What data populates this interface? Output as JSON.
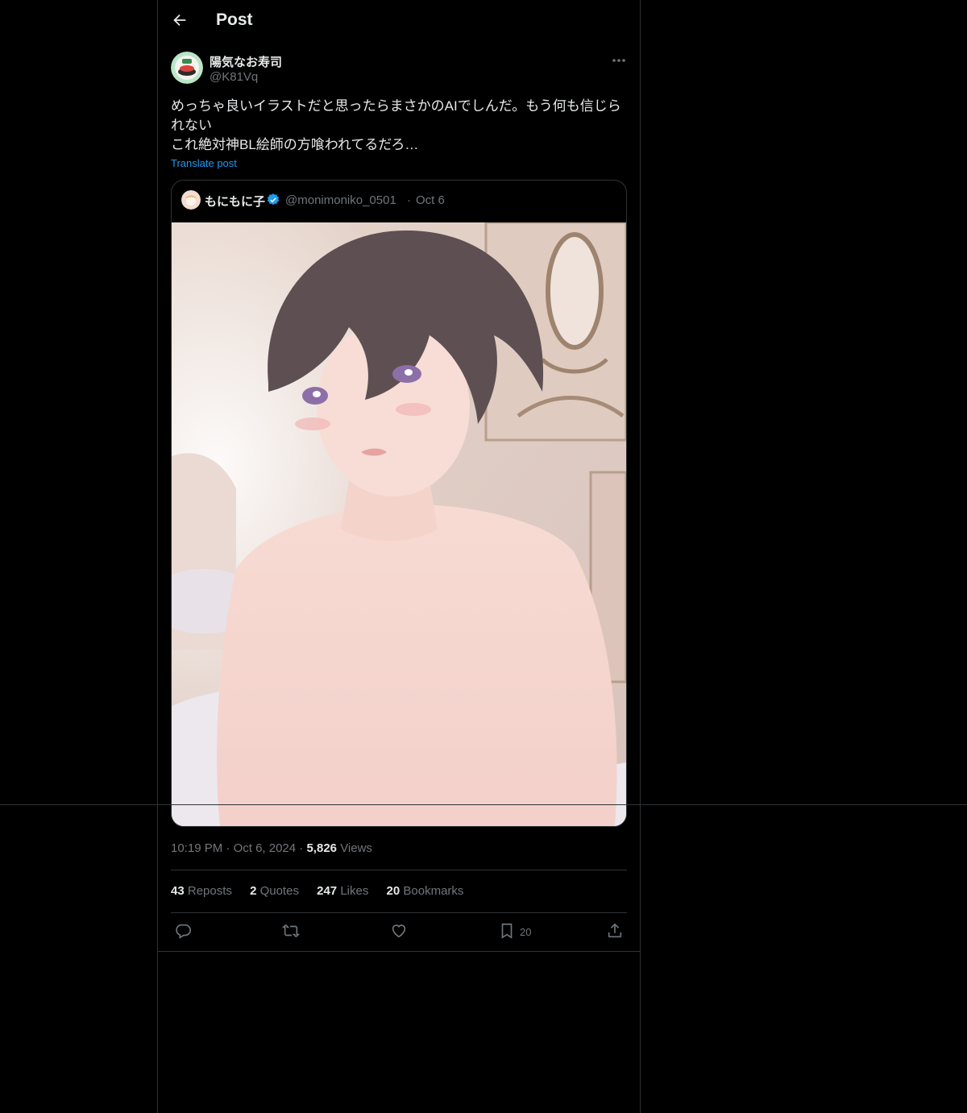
{
  "header": {
    "title": "Post"
  },
  "post": {
    "author_name": "陽気なお寿司",
    "author_handle": "@K81Vq",
    "text_lines": [
      "めっちゃ良いイラストだと思ったらまさかのAIでしんだ。もう何も信じら",
      "れない",
      "これ絶対神BL絵師の方喰われてるだろ…"
    ],
    "translate_label": "Translate post",
    "quote": {
      "name": "もにもに子",
      "handle": "@monimoniko_0501",
      "separator": "·",
      "date": "Oct 6"
    },
    "time": "10:19 PM",
    "separator": "·",
    "date": "Oct 6, 2024",
    "views_count": "5,826",
    "views_label": "Views",
    "stats": {
      "reposts_count": "43",
      "reposts_label": "Reposts",
      "quotes_count": "2",
      "quotes_label": "Quotes",
      "likes_count": "247",
      "likes_label": "Likes",
      "bookmarks_count": "20",
      "bookmarks_label": "Bookmarks"
    },
    "actions": {
      "bookmark_count": "20"
    }
  },
  "colors": {
    "accent": "#1d9bf0",
    "muted": "#71767b",
    "border": "#2f3336",
    "text": "#e7e9ea",
    "background": "#000000"
  },
  "icons": [
    "back-arrow-icon",
    "more-icon",
    "verified-badge-icon",
    "reply-icon",
    "repost-icon",
    "like-icon",
    "bookmark-icon",
    "share-icon"
  ]
}
